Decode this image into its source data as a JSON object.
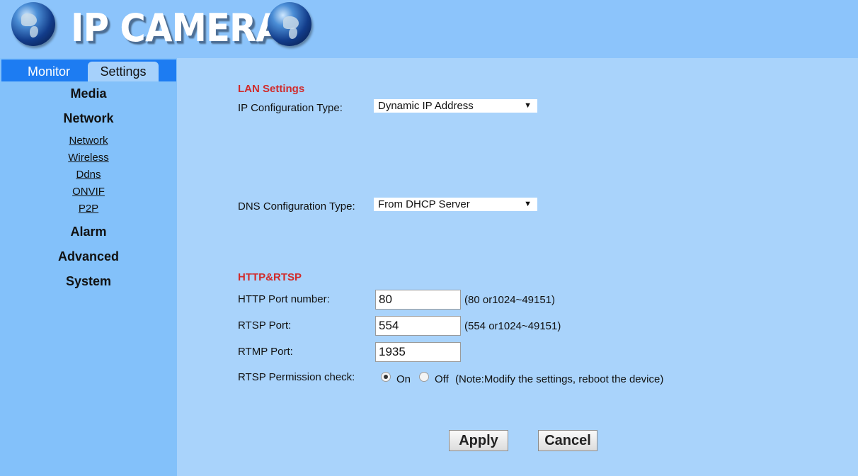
{
  "header": {
    "title": "IP CAMERA",
    "left_icon": "globe-icon",
    "right_icon": "globe-icon"
  },
  "tabs": {
    "monitor": "Monitor",
    "settings": "Settings",
    "active": "Settings"
  },
  "sidebar": {
    "media": "Media",
    "network": "Network",
    "network_links": [
      "Network",
      "Wireless",
      "Ddns",
      "ONVIF",
      "P2P"
    ],
    "alarm": "Alarm",
    "advanced": "Advanced",
    "system": "System"
  },
  "lan": {
    "title": "LAN Settings",
    "ip_config_label": "IP Configuration Type:",
    "ip_config_value": "Dynamic IP Address",
    "dns_config_label": "DNS Configuration Type:",
    "dns_config_value": "From DHCP Server"
  },
  "http_rtsp": {
    "title": "HTTP&RTSP",
    "http_port_label": "HTTP Port number:",
    "http_port_value": "80",
    "http_port_hint": "(80 or1024~49151)",
    "rtsp_port_label": "RTSP Port:",
    "rtsp_port_value": "554",
    "rtsp_port_hint": "(554 or1024~49151)",
    "rtmp_port_label": "RTMP Port:",
    "rtmp_port_value": "1935",
    "rtsp_permission_label": "RTSP Permission check:",
    "on_label": "On",
    "off_label": "Off",
    "permission_selected": "On",
    "note": "(Note:Modify the settings, reboot the device)"
  },
  "actions": {
    "apply": "Apply",
    "cancel": "Cancel"
  },
  "colors": {
    "header_bg": "#8cc4fb",
    "sidebar_bg": "#83c1fa",
    "main_bg": "#a9d3fb",
    "tabbar_bg": "#1d7cf2",
    "section_title": "#d12b2b"
  }
}
